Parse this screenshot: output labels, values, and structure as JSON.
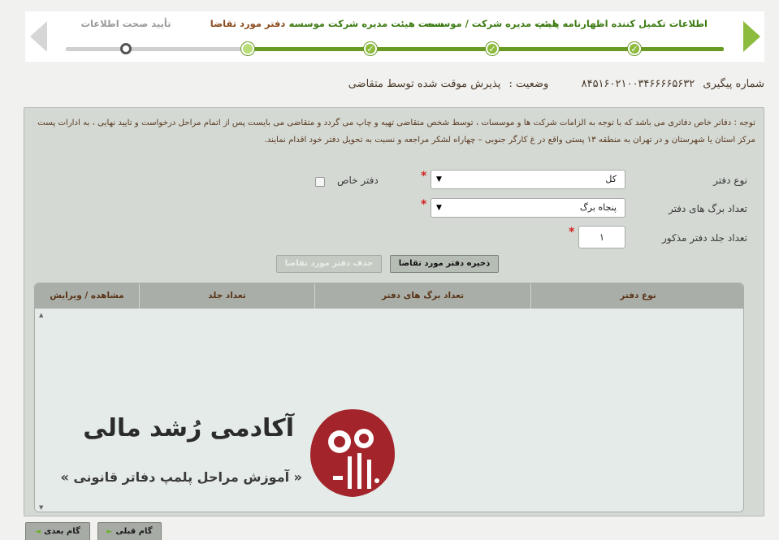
{
  "wizard": {
    "steps": [
      {
        "label": "اطلاعات تکمیل کننده اظهارنامه پلمپ",
        "state": "done"
      },
      {
        "label": "هیئت مدیره شرکت / موسسه",
        "state": "done"
      },
      {
        "label": "سمت هیئت مدیره شرکت موسسه",
        "state": "done"
      },
      {
        "label": "دفتر مورد تقاضا",
        "state": "current"
      },
      {
        "label": "تأیید صحت اطلاعات",
        "state": "pending"
      }
    ],
    "check_glyph": "✓",
    "colors": {
      "done": "#3c7b12",
      "current": "#8a4a1c",
      "pending": "#9a9a9a",
      "track": "#6a9a26"
    }
  },
  "tracking": {
    "label": "شماره پیگیری",
    "number": "۸۴۵۱۶۰۲۱۰۰۳۴۶۶۶۶۵۶۳۲",
    "status_label": "وضعیت :",
    "status_value": "پذیرش موقت شده توسط متقاضی"
  },
  "notice": "توجه : دفاتر خاص دفاتری می باشد که با توجه به الزامات شرکت ها و موسسات ، توسط شخص متقاضی تهیه و چاپ می گردد و متقاضی می بایست پس از اتمام مراحل درخواست و تایید نهایی ، به ادارات پست مرکز استان یا شهرستان و در تهران به منطقه ۱۳ پستی واقع در غ کارگر جنوبی – چهاراه لشکر مراجعه و نسبت به تحویل دفتر خود اقدام نمایند.",
  "form": {
    "book_type_label": "نوع دفتر",
    "book_type_value": "کل",
    "special_book_label": "دفتر خاص",
    "pages_label": "تعداد برگ های دفتر",
    "pages_value": "پنجاه برگ",
    "volumes_label": "تعداد جلد دفتر مذکور",
    "volumes_value": "۱",
    "required_mark": "*",
    "caret": "▼"
  },
  "buttons": {
    "save": "ذخیره دفتر مورد تقاضا",
    "delete": "حذف دفتر مورد تقاضا",
    "prev": "گام قبلی",
    "next": "گام بعدی"
  },
  "grid": {
    "columns": [
      "نوع دفتر",
      "تعداد برگ های دفتر",
      "تعداد جلد",
      "مشاهده / ویرایش"
    ],
    "rows": []
  },
  "watermark": {
    "title": "آکادمی رُشد مالی",
    "subtitle": "« آموزش مراحل پلمپ دفاتر قانونی »",
    "colors": {
      "logo": "#a3242a"
    }
  }
}
